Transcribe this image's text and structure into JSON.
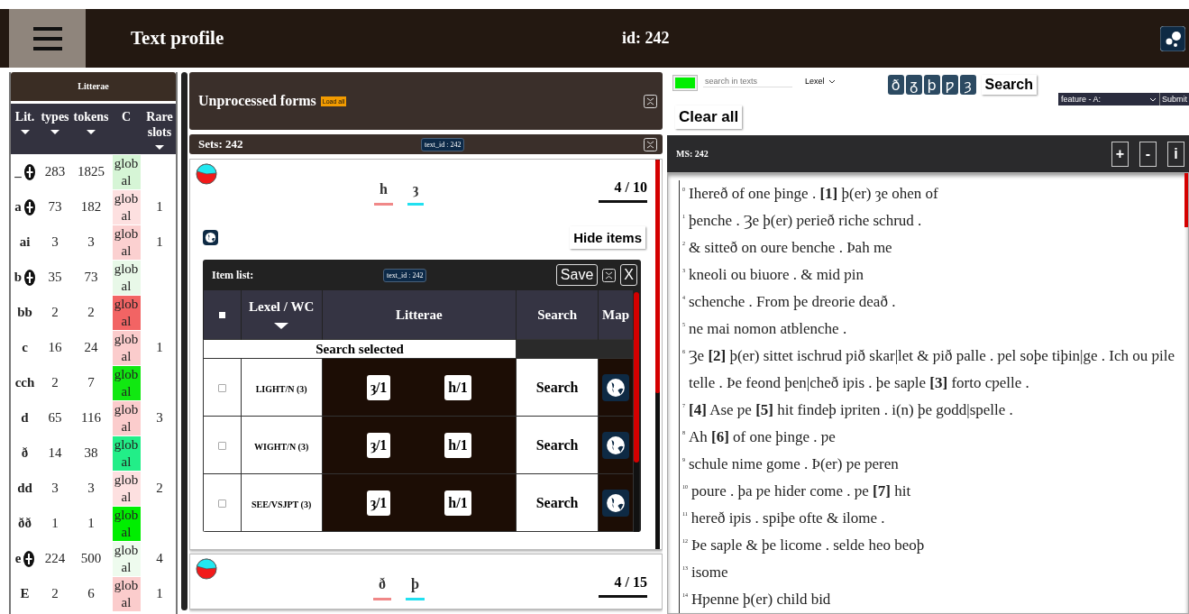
{
  "header": {
    "title": "Text profile",
    "id_label": "id: 242"
  },
  "litterae": {
    "title": "Litterae",
    "columns": [
      {
        "label": "Lit.",
        "sortable": true
      },
      {
        "label": "types",
        "sortable": true
      },
      {
        "label": "tokens",
        "sortable": true
      },
      {
        "label": "C",
        "sortable": false
      },
      {
        "label": "Rare slots",
        "sortable": true
      }
    ],
    "rows": [
      {
        "lit": "_",
        "expandable": true,
        "types": "283",
        "tokens": "1825",
        "c": "global",
        "color": "#d6f5d6"
      },
      {
        "lit": "a",
        "expandable": true,
        "types": "73",
        "tokens": "182",
        "c": "global",
        "color": "#fde0e0",
        "rare": "1"
      },
      {
        "lit": "ai",
        "expandable": false,
        "types": "3",
        "tokens": "3",
        "c": "global",
        "color": "#fbd0d0",
        "rare": "1"
      },
      {
        "lit": "b",
        "expandable": true,
        "types": "35",
        "tokens": "73",
        "c": "global",
        "color": "#e8f8e8"
      },
      {
        "lit": "bb",
        "expandable": false,
        "types": "2",
        "tokens": "2",
        "c": "global",
        "color": "#f26464"
      },
      {
        "lit": "c",
        "expandable": false,
        "types": "16",
        "tokens": "24",
        "c": "global",
        "color": "#fbcccc",
        "rare": "1"
      },
      {
        "lit": "cch",
        "expandable": false,
        "types": "2",
        "tokens": "7",
        "c": "global",
        "color": "#11e811"
      },
      {
        "lit": "d",
        "expandable": false,
        "types": "65",
        "tokens": "116",
        "c": "global",
        "color": "#fbcccc",
        "rare": "3"
      },
      {
        "lit": "ð",
        "expandable": false,
        "types": "14",
        "tokens": "38",
        "c": "global",
        "color": "#22ee88"
      },
      {
        "lit": "dd",
        "expandable": false,
        "types": "3",
        "tokens": "3",
        "c": "global",
        "color": "#fde0e0",
        "rare": "2"
      },
      {
        "lit": "ðð",
        "expandable": false,
        "types": "1",
        "tokens": "1",
        "c": "global",
        "color": "#00ee00"
      },
      {
        "lit": "e",
        "expandable": true,
        "types": "224",
        "tokens": "500",
        "c": "global",
        "color": "#eefbee",
        "rare": "4"
      },
      {
        "lit": "E",
        "expandable": false,
        "types": "2",
        "tokens": "6",
        "c": "global",
        "color": "#fbcccc",
        "rare": "1"
      }
    ]
  },
  "unprocessed": {
    "title": "Unprocessed forms",
    "load_button": "Load all"
  },
  "sets": {
    "title": "Sets: 242",
    "badge": "text_id : 242",
    "cards": [
      {
        "letters": [
          {
            "char": "h",
            "color": "#f08888"
          },
          {
            "char": "ȝ",
            "color": "#22e0f0"
          }
        ],
        "count": "4 / 10",
        "hide_button": "Hide items",
        "item_list": {
          "title": "Item list:",
          "badge": "text_id : 242",
          "save": "Save",
          "close": "X",
          "columns": [
            {
              "label": "Lexel / WC",
              "sortable": true
            },
            {
              "label": "Litterae",
              "sortable": false
            },
            {
              "label": "Search",
              "sortable": false
            },
            {
              "label": "Map",
              "sortable": false
            }
          ],
          "search_selected": "Search selected",
          "rows": [
            {
              "checked": false,
              "lexel": "LIGHT/N (3)",
              "litterae": [
                "ȝ/1",
                "h/1"
              ],
              "search": "Search"
            },
            {
              "checked": false,
              "lexel": "WIGHT/N (3)",
              "litterae": [
                "ȝ/1",
                "h/1"
              ],
              "search": "Search"
            },
            {
              "checked": false,
              "lexel": "SEE/VSJPT (3)",
              "litterae": [
                "ȝ/1",
                "h/1"
              ],
              "search": "Search"
            }
          ]
        }
      },
      {
        "letters": [
          {
            "char": "ð",
            "color": "#f08888"
          },
          {
            "char": "þ",
            "color": "#22e0f0"
          }
        ],
        "count": "4 / 15"
      }
    ]
  },
  "toolbar": {
    "color": "#00ee00",
    "search_placeholder": "search in texts",
    "select": "Lexel",
    "chars": [
      "ð",
      "ᵹ",
      "þ",
      "ƿ",
      "ȝ"
    ],
    "search_button": "Search",
    "feature_select": "feature - A:",
    "submit": "Submit",
    "clear": "Clear all"
  },
  "manuscript": {
    "title": "MS: 242",
    "buttons": [
      "+",
      "-",
      "i"
    ],
    "lines": [
      {
        "num": "0",
        "text": "Ihereð of one þinge . **[1]** þ(er) ȝe ohen of"
      },
      {
        "num": "1",
        "text": "þenche . Ȝe þ(er) ƿerieð riche schrud ."
      },
      {
        "num": "2",
        "text": "& sitteð on oure benche . Þah me"
      },
      {
        "num": "3",
        "text": "kneoli ou biuore . & mid ƿin"
      },
      {
        "num": "4",
        "text": "schenche . From þe dreorie deað ."
      },
      {
        "num": "5",
        "text": "ne mai nomon atblenche ."
      },
      {
        "num": "6",
        "text": "Ȝe **[2]** þ(er) sittet ischrud ƿið skar|let & ƿið palle . ƿel soþe tiþin|ge . Ich ou ƿile telle . Þe feond þen|cheð iƿis . þe saƿle **[3]** forto cƿelle ."
      },
      {
        "num": "7",
        "text": "**[4]** Ase ƿe **[5]** hit findeþ iƿriten . i(n) þe godd|spelle ."
      },
      {
        "num": "8",
        "text": "Ah **[6]** of one þinge . ƿe"
      },
      {
        "num": "9",
        "text": "schule nime gome . Þ(er) ƿe ƿeren"
      },
      {
        "num": "10",
        "text": "poure . þa ƿe hider come . ƿe **[7]** hit"
      },
      {
        "num": "11",
        "text": "hereð iƿis . spiþe ofte & ilome ."
      },
      {
        "num": "12",
        "text": "Þe saƿle & þe licome . selde heo beoþ"
      },
      {
        "num": "13",
        "text": "isome"
      },
      {
        "num": "14",
        "text": "Hƿenne þ(er) child bid"
      }
    ]
  }
}
